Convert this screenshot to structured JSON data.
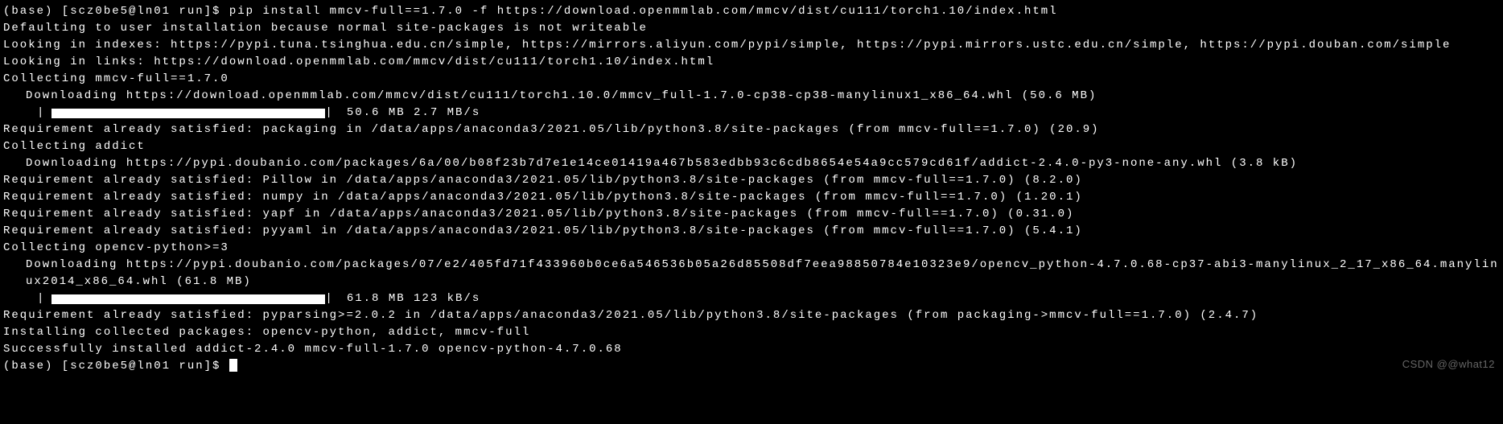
{
  "terminal": {
    "prompt": "(base) [scz0be5@ln01 run]$ ",
    "command": "pip install mmcv-full==1.7.0 -f https://download.openmmlab.com/mmcv/dist/cu111/torch1.10/index.html",
    "lines": {
      "l1": "Defaulting to user installation because normal site-packages is not writeable",
      "l2": "Looking in indexes: https://pypi.tuna.tsinghua.edu.cn/simple, https://mirrors.aliyun.com/pypi/simple, https://pypi.mirrors.ustc.edu.cn/simple, https://pypi.douban.com/simple",
      "l3": "Looking in links: https://download.openmmlab.com/mmcv/dist/cu111/torch1.10/index.html",
      "l4": "Collecting mmcv-full==1.7.0",
      "l5": "Downloading https://download.openmmlab.com/mmcv/dist/cu111/torch1.10.0/mmcv_full-1.7.0-cp38-cp38-manylinux1_x86_64.whl (50.6 MB)",
      "progress1": "50.6 MB 2.7 MB/s",
      "l6": "Requirement already satisfied: packaging in /data/apps/anaconda3/2021.05/lib/python3.8/site-packages (from mmcv-full==1.7.0) (20.9)",
      "l7": "Collecting addict",
      "l8": "Downloading https://pypi.doubanio.com/packages/6a/00/b08f23b7d7e1e14ce01419a467b583edbb93c6cdb8654e54a9cc579cd61f/addict-2.4.0-py3-none-any.whl (3.8 kB)",
      "l9": "Requirement already satisfied: Pillow in /data/apps/anaconda3/2021.05/lib/python3.8/site-packages (from mmcv-full==1.7.0) (8.2.0)",
      "l10": "Requirement already satisfied: numpy in /data/apps/anaconda3/2021.05/lib/python3.8/site-packages (from mmcv-full==1.7.0) (1.20.1)",
      "l11": "Requirement already satisfied: yapf in /data/apps/anaconda3/2021.05/lib/python3.8/site-packages (from mmcv-full==1.7.0) (0.31.0)",
      "l12": "Requirement already satisfied: pyyaml in /data/apps/anaconda3/2021.05/lib/python3.8/site-packages (from mmcv-full==1.7.0) (5.4.1)",
      "l13": "Collecting opencv-python>=3",
      "l14": "Downloading https://pypi.doubanio.com/packages/07/e2/405fd71f433960b0ce6a546536b05a26d85508df7eea98850784e10323e9/opencv_python-4.7.0.68-cp37-abi3-manylinux_2_17_x86_64.manylinux2014_x86_64.whl (61.8 MB)",
      "progress2": "61.8 MB 123 kB/s",
      "l15": "Requirement already satisfied: pyparsing>=2.0.2 in /data/apps/anaconda3/2021.05/lib/python3.8/site-packages (from packaging->mmcv-full==1.7.0) (2.4.7)",
      "l16": "Installing collected packages: opencv-python, addict, mmcv-full",
      "l17": "Successfully installed addict-2.4.0 mmcv-full-1.7.0 opencv-python-4.7.0.68"
    },
    "final_prompt": "(base) [scz0be5@ln01 run]$ "
  },
  "watermark": "CSDN @@what12"
}
